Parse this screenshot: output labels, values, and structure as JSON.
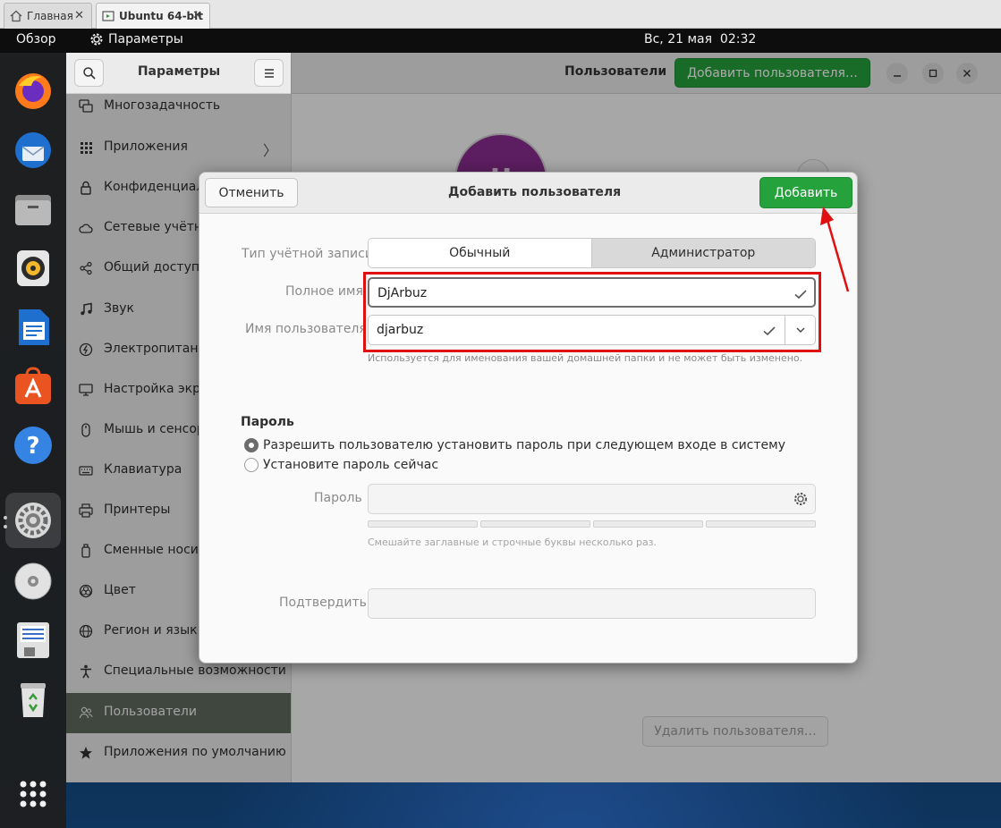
{
  "host_tabs": [
    {
      "label": "Главная",
      "icon": "home-icon",
      "close": "✕"
    },
    {
      "label": "Ubuntu 64-bit",
      "icon": "vm-icon",
      "close": "✕"
    }
  ],
  "topbar": {
    "overview": "Обзор",
    "app_name": "Параметры",
    "clock": "Вс, 21 мая  02:32"
  },
  "dock": [
    "firefox-icon",
    "thunderbird-icon",
    "files-icon",
    "rhythmbox-icon",
    "libreoffice-writer-icon",
    "app-center-icon",
    "help-icon",
    "settings-icon",
    "dvd-icon",
    "floppy-icon",
    "trash-icon",
    "show-apps-icon"
  ],
  "sidebar": {
    "title": "Параметры",
    "items": [
      {
        "label": "Многозадачность",
        "icon": "multitasking-icon"
      },
      {
        "label": "Приложения",
        "icon": "apps-grid-icon",
        "arrow": "〉"
      },
      {
        "label": "Конфиденциальность",
        "icon": "lock-icon"
      },
      {
        "label": "Сетевые учётные записи",
        "icon": "cloud-icon"
      },
      {
        "label": "Общий доступ",
        "icon": "share-icon"
      },
      {
        "label": "Звук",
        "icon": "music-note-icon"
      },
      {
        "label": "Электропитание",
        "icon": "power-icon"
      },
      {
        "label": "Настройка экранов",
        "icon": "display-icon"
      },
      {
        "label": "Мышь и сенсорная панель",
        "icon": "mouse-icon"
      },
      {
        "label": "Клавиатура",
        "icon": "keyboard-icon"
      },
      {
        "label": "Принтеры",
        "icon": "printer-icon"
      },
      {
        "label": "Сменные носители",
        "icon": "removable-media-icon"
      },
      {
        "label": "Цвет",
        "icon": "color-icon"
      },
      {
        "label": "Регион и язык",
        "icon": "globe-icon"
      },
      {
        "label": "Специальные возможности",
        "icon": "accessibility-icon"
      },
      {
        "label": "Пользователи",
        "icon": "users-icon",
        "selected": true
      },
      {
        "label": "Приложения по умолчанию",
        "icon": "star-icon"
      }
    ]
  },
  "main": {
    "title": "Пользователи",
    "add_user_button": "Добавить пользователя…",
    "avatar_initial": "U",
    "delete_user_button": "Удалить пользователя…"
  },
  "dialog": {
    "cancel": "Отменить",
    "title": "Добавить пользователя",
    "add": "Добавить",
    "account_type_label": "Тип учётной записи",
    "account_types": [
      "Обычный",
      "Администратор"
    ],
    "fullname_label": "Полное имя",
    "fullname_value": "DjArbuz",
    "username_label": "Имя пользователя",
    "username_value": "djarbuz",
    "username_hint": "Используется для именования вашей домашней папки и не может быть изменено.",
    "password_heading": "Пароль",
    "radio_set_later": "Разрешить пользователю установить пароль при следующем входе в систему",
    "radio_set_now": "Установите пароль сейчас",
    "password_label": "Пароль",
    "password_hint": "Смешайте заглавные и строчные буквы несколько раз.",
    "confirm_label": "Подтвердить"
  },
  "colors": {
    "accent_green": "#26a23d",
    "annotation_red": "#e01010",
    "selected_sidebar": "#5e6a5e",
    "avatar_purple": "#8a2d8f"
  }
}
